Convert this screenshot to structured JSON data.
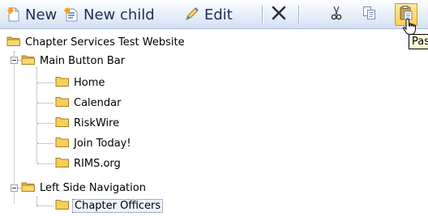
{
  "toolbar": {
    "new_label": "New",
    "new_child_label": "New child",
    "edit_label": "Edit",
    "delete_icon": "close-x-icon",
    "cut_icon": "scissors-icon",
    "copy_icon": "copy-icon",
    "paste_icon": "paste-icon",
    "paste_tooltip": "Pas"
  },
  "tree": {
    "root": {
      "label": "Chapter Services Test Website"
    },
    "groups": [
      {
        "label": "Main Button Bar",
        "expanded": true,
        "children": [
          "Home",
          "Calendar",
          "RiskWire",
          "Join Today!",
          "RIMS.org"
        ]
      },
      {
        "label": "Left Side Navigation",
        "expanded": true,
        "children": [
          "Chapter Officers"
        ]
      }
    ],
    "selected": "Chapter Officers"
  },
  "colors": {
    "toolbar_text": "#1f2f55",
    "folder": "#f2c94a",
    "paste_highlight": "#ffce5a"
  }
}
